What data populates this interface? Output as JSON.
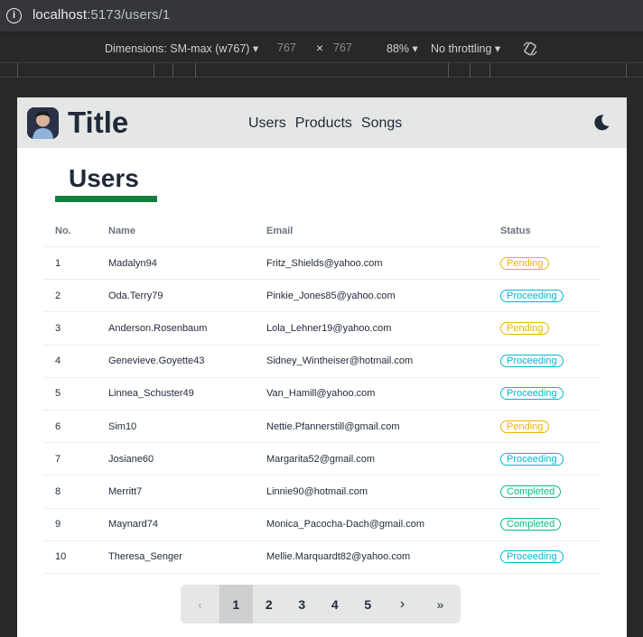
{
  "browser": {
    "url_host": "localhost",
    "url_path": ":5173/users/1"
  },
  "devtools": {
    "dimensions_label": "Dimensions: SM-max (w767) ▾",
    "width": "767",
    "times": "×",
    "height": "767",
    "zoom": "88% ▾",
    "throttling": "No throttling ▾"
  },
  "navbar": {
    "brand": "Title",
    "links": [
      "Users",
      "Products",
      "Songs"
    ]
  },
  "page": {
    "title": "Users",
    "accent": "#15803d"
  },
  "table": {
    "headers": [
      "No.",
      "Name",
      "Email",
      "Status"
    ],
    "rows": [
      {
        "no": "1",
        "name": "Madalyn94",
        "email": "Fritz_Shields@yahoo.com",
        "status": "Pending"
      },
      {
        "no": "2",
        "name": "Oda.Terry79",
        "email": "Pinkie_Jones85@yahoo.com",
        "status": "Proceeding"
      },
      {
        "no": "3",
        "name": "Anderson.Rosenbaum",
        "email": "Lola_Lehner19@yahoo.com",
        "status": "Pending"
      },
      {
        "no": "4",
        "name": "Genevieve.Goyette43",
        "email": "Sidney_Wintheiser@hotmail.com",
        "status": "Proceeding"
      },
      {
        "no": "5",
        "name": "Linnea_Schuster49",
        "email": "Van_Hamill@yahoo.com",
        "status": "Proceeding"
      },
      {
        "no": "6",
        "name": "Sim10",
        "email": "Nettie.Pfannerstill@gmail.com",
        "status": "Pending"
      },
      {
        "no": "7",
        "name": "Josiane60",
        "email": "Margarita52@gmail.com",
        "status": "Proceeding"
      },
      {
        "no": "8",
        "name": "Merritt7",
        "email": "Linnie90@hotmail.com",
        "status": "Completed"
      },
      {
        "no": "9",
        "name": "Maynard74",
        "email": "Monica_Pacocha-Dach@gmail.com",
        "status": "Completed"
      },
      {
        "no": "10",
        "name": "Theresa_Senger",
        "email": "Mellie.Marquardt82@yahoo.com",
        "status": "Proceeding"
      }
    ],
    "status_colors": {
      "Pending": "#eab308",
      "Proceeding": "#06b6d4",
      "Completed": "#10b981"
    }
  },
  "pagination": {
    "first": "‹",
    "pages": [
      "1",
      "2",
      "3",
      "4",
      "5"
    ],
    "active": "1",
    "next": "›",
    "last": "»"
  }
}
